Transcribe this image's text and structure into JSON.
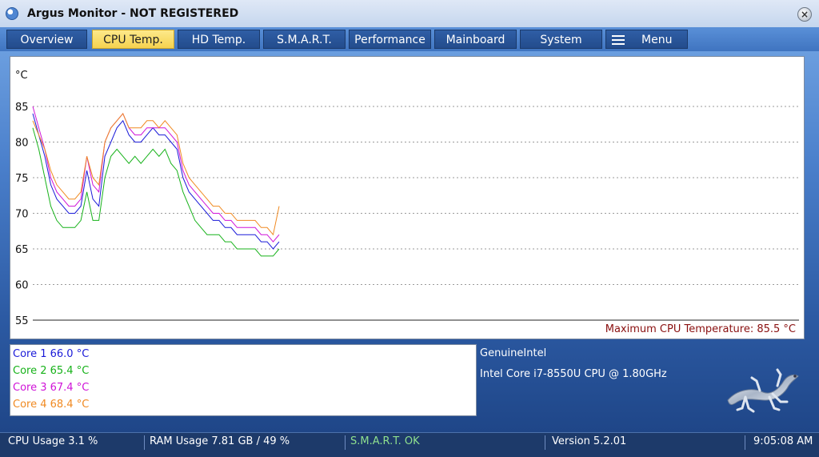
{
  "window": {
    "title": "Argus Monitor - NOT REGISTERED",
    "close_glyph": "×"
  },
  "tabs": [
    {
      "label": "Overview",
      "active": false
    },
    {
      "label": "CPU Temp.",
      "active": true
    },
    {
      "label": "HD Temp.",
      "active": false
    },
    {
      "label": "S.M.A.R.T.",
      "active": false
    },
    {
      "label": "Performance",
      "active": false
    },
    {
      "label": "Mainboard",
      "active": false
    },
    {
      "label": "System",
      "active": false
    },
    {
      "label": "Menu",
      "active": false
    }
  ],
  "chart": {
    "unit_label": "°C",
    "max_temp_label": "Maximum CPU Temperature: 85.5 °C"
  },
  "chart_data": {
    "type": "line",
    "ylim": [
      55,
      85
    ],
    "yticks": [
      "85",
      "80",
      "75",
      "70",
      "65",
      "60",
      "55"
    ],
    "grid": true,
    "series": [
      {
        "name": "Core 1",
        "color": "#1a1ad8",
        "values": [
          84,
          81,
          78,
          74,
          72,
          71,
          70,
          70,
          71,
          76,
          72,
          71,
          78,
          80,
          82,
          83,
          81,
          80,
          80,
          81,
          82,
          81,
          81,
          80,
          79,
          75,
          73,
          72,
          71,
          70,
          69,
          69,
          68,
          68,
          67,
          67,
          67,
          67,
          66,
          66,
          65,
          66
        ]
      },
      {
        "name": "Core 2",
        "color": "#17b21a",
        "values": [
          82,
          79,
          75,
          71,
          69,
          68,
          68,
          68,
          69,
          73,
          69,
          69,
          75,
          78,
          79,
          78,
          77,
          78,
          77,
          78,
          79,
          78,
          79,
          77,
          76,
          73,
          71,
          69,
          68,
          67,
          67,
          67,
          66,
          66,
          65,
          65,
          65,
          65,
          64,
          64,
          64,
          65
        ]
      },
      {
        "name": "Core 3",
        "color": "#d014d8",
        "values": [
          85,
          82,
          79,
          75,
          73,
          72,
          71,
          71,
          72,
          78,
          74,
          73,
          80,
          82,
          83,
          84,
          82,
          81,
          81,
          82,
          82,
          82,
          82,
          81,
          80,
          76,
          74,
          73,
          72,
          71,
          70,
          70,
          69,
          69,
          68,
          68,
          68,
          68,
          67,
          67,
          66,
          67
        ]
      },
      {
        "name": "Core 4",
        "color": "#f08a22",
        "values": [
          83,
          81,
          79,
          76,
          74,
          73,
          72,
          72,
          73,
          78,
          75,
          74,
          80,
          82,
          83,
          84,
          82,
          82,
          82,
          83,
          83,
          82,
          83,
          82,
          81,
          77,
          75,
          74,
          73,
          72,
          71,
          71,
          70,
          70,
          69,
          69,
          69,
          69,
          68,
          68,
          67,
          71
        ]
      }
    ]
  },
  "cores": [
    {
      "label": "Core 1 66.0 °C",
      "color": "#1a1ad8"
    },
    {
      "label": "Core 2 65.4 °C",
      "color": "#17b21a"
    },
    {
      "label": "Core 3 67.4 °C",
      "color": "#d014d8"
    },
    {
      "label": "Core 4 68.4 °C",
      "color": "#f08a22"
    }
  ],
  "cpu": {
    "vendor": "GenuineIntel",
    "model": "Intel Core i7-8550U CPU @ 1.80GHz"
  },
  "status": {
    "cpu_usage": "CPU Usage 3.1 %",
    "ram_usage": "RAM Usage 7.81 GB / 49 %",
    "smart": "S.M.A.R.T. OK",
    "version": "Version 5.2.01",
    "time": "9:05:08 AM"
  },
  "colors": {
    "smart_ok": "#8fe08f",
    "max_temp": "#8a1010",
    "active_tab": "#f5d24f"
  }
}
